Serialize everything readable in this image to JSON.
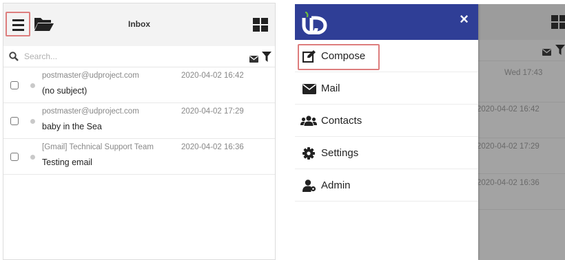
{
  "left": {
    "header": {
      "title": "Inbox"
    },
    "search": {
      "placeholder": "Search..."
    },
    "messages": [
      {
        "from": "postmaster@udproject.com",
        "date": "2020-04-02 16:42",
        "subject": "(no subject)"
      },
      {
        "from": "postmaster@udproject.com",
        "date": "2020-04-02 17:29",
        "subject": "baby in the Sea"
      },
      {
        "from": "[Gmail] Technical Support Team",
        "date": "2020-04-02 16:36",
        "subject": "Testing email"
      }
    ]
  },
  "right": {
    "drawer": {
      "close_glyph": "×",
      "items": [
        {
          "label": "Compose",
          "icon": "compose-icon"
        },
        {
          "label": "Mail",
          "icon": "envelope-icon"
        },
        {
          "label": "Contacts",
          "icon": "users-icon"
        },
        {
          "label": "Settings",
          "icon": "gear-icon"
        },
        {
          "label": "Admin",
          "icon": "user-admin-icon"
        }
      ]
    },
    "background_dates": [
      "Wed 17:43",
      "2020-04-02 16:42",
      "2020-04-02 17:29",
      "2020-04-02 16:36"
    ]
  },
  "colors": {
    "drawer_header": "#2f3e96",
    "highlight_outline": "#dd7d7d",
    "logo_leaf": "#6fbf3a"
  }
}
